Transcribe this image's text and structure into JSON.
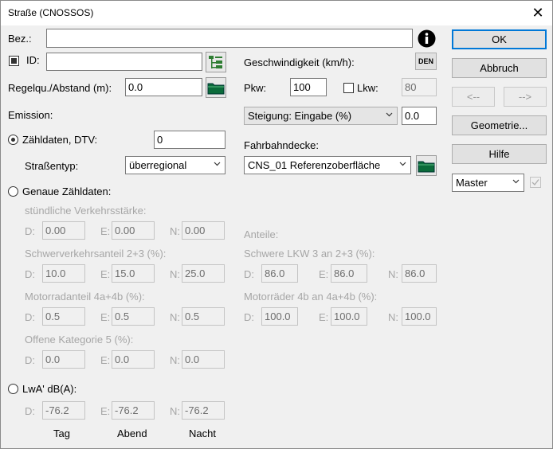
{
  "window": {
    "title": "Straße (CNOSSOS)",
    "close_glyph": "✕"
  },
  "left": {
    "bez_label": "Bez.:",
    "bez_value": "",
    "id_label": "ID:",
    "id_value": "",
    "regelqu_label": "Regelqu./Abstand (m):",
    "regelqu_value": "0.0",
    "emission_label": "Emission:",
    "zaehldaten_label": "Zähldaten, DTV:",
    "zaehldaten_value": "0",
    "strassentyp_label": "Straßentyp:",
    "strassentyp_value": "überregional",
    "genaue_label": "Genaue Zähldaten:",
    "stuendlich_label": "stündliche Verkehrsstärke:",
    "schwer_label": "Schwerverkehrsanteil 2+3  (%):",
    "motorrad_label": "Motorradanteil 4a+4b (%):",
    "offene_label": "Offene Kategorie 5 (%):",
    "lwa_label": "LwA' dB(A):",
    "d_label": "D:",
    "e_label": "E:",
    "n_label": "N:",
    "stuendlich": {
      "d": "0.00",
      "e": "0.00",
      "n": "0.00"
    },
    "schwer": {
      "d": "10.0",
      "e": "15.0",
      "n": "25.0"
    },
    "motorrad": {
      "d": "0.5",
      "e": "0.5",
      "n": "0.5"
    },
    "offene": {
      "d": "0.0",
      "e": "0.0",
      "n": "0.0"
    },
    "lwa": {
      "d": "-76.2",
      "e": "-76.2",
      "n": "-76.2"
    },
    "footer": {
      "tag": "Tag",
      "abend": "Abend",
      "nacht": "Nacht"
    }
  },
  "right": {
    "geschw_label": "Geschwindigkeit (km/h):",
    "den_label": "DEN",
    "pkw_label": "Pkw:",
    "pkw_value": "100",
    "lkw_label": "Lkw:",
    "lkw_value": "80",
    "steigung_value": "Steigung: Eingabe (%)",
    "steigung_input": "0.0",
    "fahrbahn_label": "Fahrbahndecke:",
    "fahrbahn_value": "CNS_01 Referenzoberfläche",
    "anteile_label": "Anteile:",
    "schwere_lkw_label": "Schwere LKW 3 an 2+3 (%):",
    "motorraeder_label": "Motorräder 4b an 4a+4b (%):",
    "schwere_lkw": {
      "d": "86.0",
      "e": "86.0",
      "n": "86.0"
    },
    "motorraeder": {
      "d": "100.0",
      "e": "100.0",
      "n": "100.0"
    }
  },
  "buttons": {
    "ok": "OK",
    "abbruch": "Abbruch",
    "prev": "<--",
    "next": "-->",
    "geometrie": "Geometrie...",
    "hilfe": "Hilfe",
    "master": "Master"
  }
}
